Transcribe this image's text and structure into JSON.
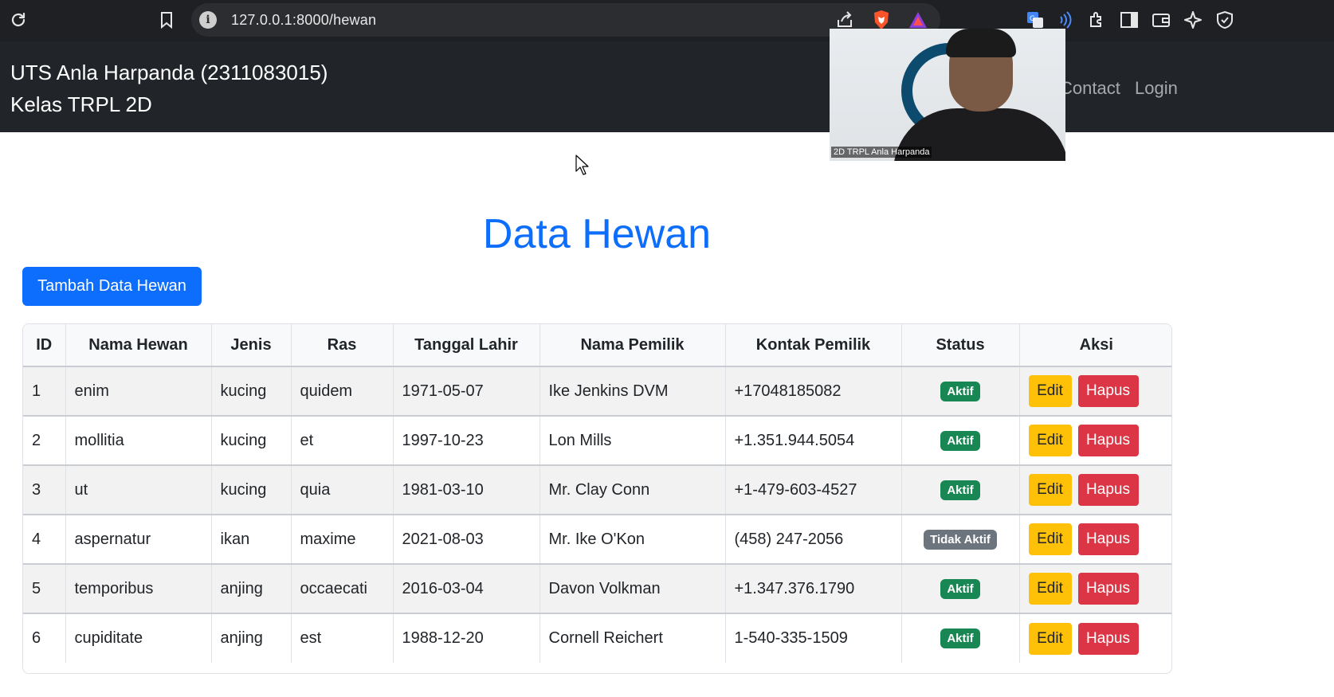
{
  "browser": {
    "url": "127.0.0.1:8000/hewan"
  },
  "navbar": {
    "brand_line1": "UTS Anla Harpanda (2311083015)",
    "brand_line2": "Kelas TRPL 2D",
    "links": [
      "Contact",
      "Login"
    ]
  },
  "webcam": {
    "label": "2D TRPL Anla Harpanda"
  },
  "page": {
    "title": "Data Hewan",
    "add_button": "Tambah Data Hewan"
  },
  "table": {
    "headers": [
      "ID",
      "Nama Hewan",
      "Jenis",
      "Ras",
      "Tanggal Lahir",
      "Nama Pemilik",
      "Kontak Pemilik",
      "Status",
      "Aksi"
    ],
    "edit_label": "Edit",
    "delete_label": "Hapus",
    "rows": [
      {
        "id": "1",
        "nama": "enim",
        "jenis": "kucing",
        "ras": "quidem",
        "tanggal": "1971-05-07",
        "pemilik": "Ike Jenkins DVM",
        "kontak": "+17048185082",
        "status": "Aktif"
      },
      {
        "id": "2",
        "nama": "mollitia",
        "jenis": "kucing",
        "ras": "et",
        "tanggal": "1997-10-23",
        "pemilik": "Lon Mills",
        "kontak": "+1.351.944.5054",
        "status": "Aktif"
      },
      {
        "id": "3",
        "nama": "ut",
        "jenis": "kucing",
        "ras": "quia",
        "tanggal": "1981-03-10",
        "pemilik": "Mr. Clay Conn",
        "kontak": "+1-479-603-4527",
        "status": "Aktif"
      },
      {
        "id": "4",
        "nama": "aspernatur",
        "jenis": "ikan",
        "ras": "maxime",
        "tanggal": "2021-08-03",
        "pemilik": "Mr. Ike O'Kon",
        "kontak": "(458) 247-2056",
        "status": "Tidak Aktif"
      },
      {
        "id": "5",
        "nama": "temporibus",
        "jenis": "anjing",
        "ras": "occaecati",
        "tanggal": "2016-03-04",
        "pemilik": "Davon Volkman",
        "kontak": "+1.347.376.1790",
        "status": "Aktif"
      },
      {
        "id": "6",
        "nama": "cupiditate",
        "jenis": "anjing",
        "ras": "est",
        "tanggal": "1988-12-20",
        "pemilik": "Cornell Reichert",
        "kontak": "1-540-335-1509",
        "status": "Aktif"
      }
    ]
  },
  "colors": {
    "primary": "#0d6efd",
    "navbar_bg": "#212529",
    "warning": "#ffc107",
    "danger": "#dc3545",
    "success": "#198754",
    "secondary": "#6c757d"
  },
  "icons": {
    "chrome_left": [
      "reload-icon",
      "bookmark-icon"
    ],
    "address_right": [
      "share-icon",
      "brave-shield-icon",
      "brave-rewards-icon"
    ],
    "toolbar_right": [
      "translate-icon",
      "read-aloud-icon",
      "extensions-icon",
      "sidebar-icon",
      "wallet-icon",
      "leo-ai-icon",
      "vpn-icon"
    ]
  }
}
